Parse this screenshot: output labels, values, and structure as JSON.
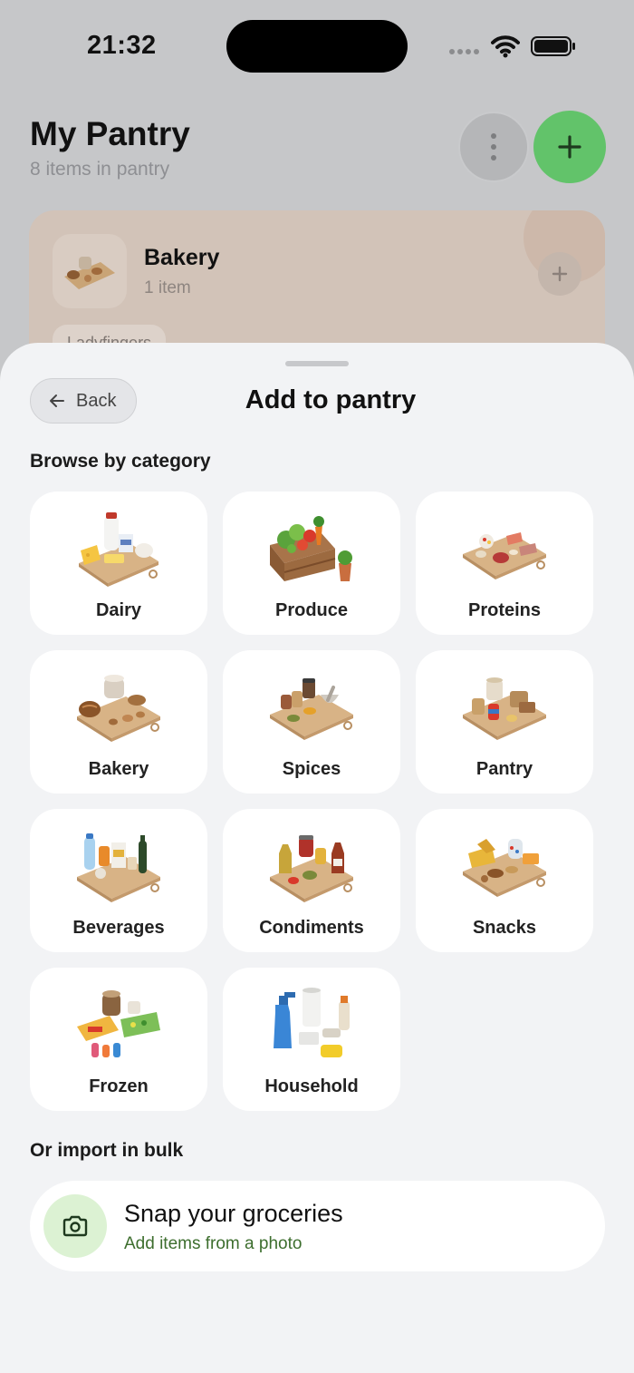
{
  "status_bar": {
    "time": "21:32"
  },
  "header": {
    "title": "My Pantry",
    "subtitle": "8 items in pantry"
  },
  "background_card": {
    "title": "Bakery",
    "count": "1 item",
    "chip": "Ladyfingers"
  },
  "sheet": {
    "back_label": "Back",
    "title": "Add to pantry",
    "browse_label": "Browse by category",
    "categories": [
      {
        "label": "Dairy",
        "icon": "dairy-board-icon"
      },
      {
        "label": "Produce",
        "icon": "produce-crate-icon"
      },
      {
        "label": "Proteins",
        "icon": "proteins-board-icon"
      },
      {
        "label": "Bakery",
        "icon": "bakery-board-icon"
      },
      {
        "label": "Spices",
        "icon": "spices-board-icon"
      },
      {
        "label": "Pantry",
        "icon": "pantry-board-icon"
      },
      {
        "label": "Beverages",
        "icon": "beverages-board-icon"
      },
      {
        "label": "Condiments",
        "icon": "condiments-board-icon"
      },
      {
        "label": "Snacks",
        "icon": "snacks-board-icon"
      },
      {
        "label": "Frozen",
        "icon": "frozen-items-icon"
      },
      {
        "label": "Household",
        "icon": "household-items-icon"
      }
    ],
    "bulk_label": "Or import in bulk",
    "snap": {
      "title": "Snap your groceries",
      "subtitle": "Add items from a photo",
      "icon": "camera-icon"
    }
  },
  "colors": {
    "accent_green": "#62c36a",
    "sheet_background": "#f2f3f5",
    "tile_background": "#ffffff",
    "snap_icon_background": "#dcf2d3",
    "snap_subtitle": "#3d6e2e"
  }
}
